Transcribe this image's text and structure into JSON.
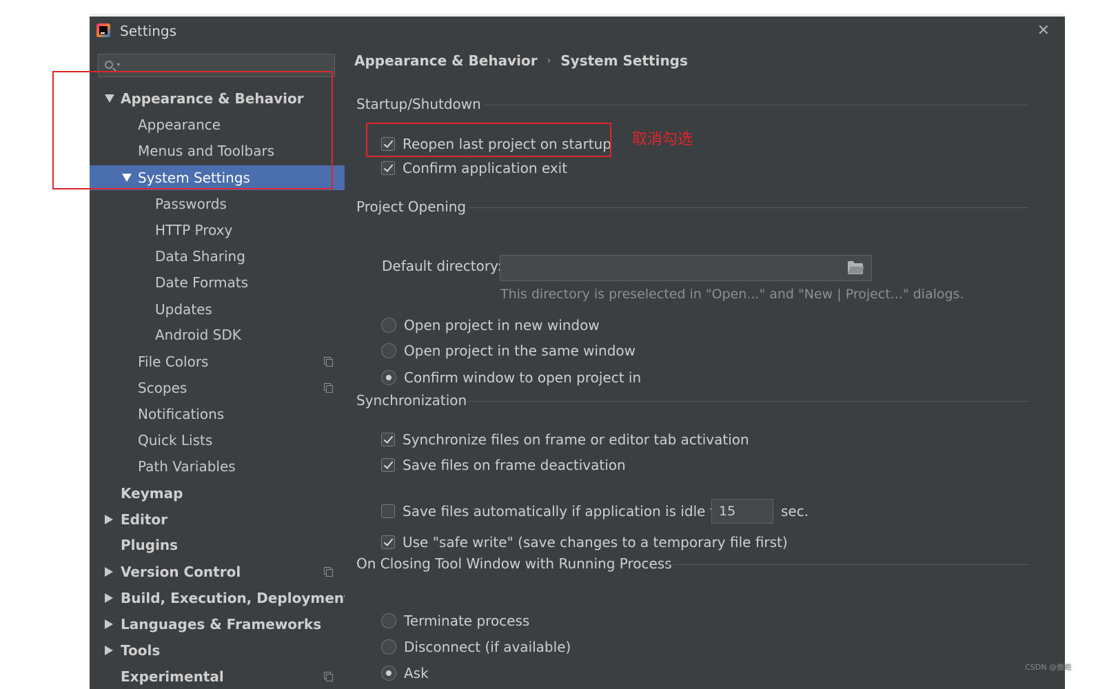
{
  "window": {
    "title": "Settings"
  },
  "sidebar": {
    "search_placeholder": "",
    "items": [
      {
        "label": "Appearance & Behavior"
      },
      {
        "label": "Appearance"
      },
      {
        "label": "Menus and Toolbars"
      },
      {
        "label": "System Settings"
      },
      {
        "label": "Passwords"
      },
      {
        "label": "HTTP Proxy"
      },
      {
        "label": "Data Sharing"
      },
      {
        "label": "Date Formats"
      },
      {
        "label": "Updates"
      },
      {
        "label": "Android SDK"
      },
      {
        "label": "File Colors"
      },
      {
        "label": "Scopes"
      },
      {
        "label": "Notifications"
      },
      {
        "label": "Quick Lists"
      },
      {
        "label": "Path Variables"
      },
      {
        "label": "Keymap"
      },
      {
        "label": "Editor"
      },
      {
        "label": "Plugins"
      },
      {
        "label": "Version Control"
      },
      {
        "label": "Build, Execution, Deployment"
      },
      {
        "label": "Languages & Frameworks"
      },
      {
        "label": "Tools"
      },
      {
        "label": "Experimental"
      }
    ]
  },
  "main": {
    "breadcrumb": [
      "Appearance & Behavior",
      "System Settings"
    ],
    "breadcrumb_sep": "›",
    "startup": {
      "title": "Startup/Shutdown",
      "reopen_label": "Reopen last project on startup",
      "confirm_exit_label": "Confirm application exit"
    },
    "project_opening": {
      "title": "Project Opening",
      "default_dir_label": "Default directory:",
      "default_dir_value": "",
      "hint": "This directory is preselected in \"Open...\" and \"New | Project...\" dialogs.",
      "radio_new": "Open project in new window",
      "radio_same": "Open project in the same window",
      "radio_confirm": "Confirm window to open project in"
    },
    "sync": {
      "title": "Synchronization",
      "sync_files_label": "Synchronize files on frame or editor tab activation",
      "save_deactivation_label": "Save files on frame deactivation",
      "save_idle_label": "Save files automatically if application is idle for",
      "idle_value": "15",
      "sec_label": "sec.",
      "safe_write_label": "Use \"safe write\" (save changes to a temporary file first)"
    },
    "closing": {
      "title": "On Closing Tool Window with Running Process",
      "terminate_label": "Terminate process",
      "disconnect_label": "Disconnect (if available)",
      "ask_label": "Ask"
    }
  },
  "annotation": {
    "text": "取消勾选",
    "color": "#e0252b"
  },
  "watermark": "CSDN @傲羲",
  "colors": {
    "background": "#3c3f41",
    "selected": "#4b6eaf",
    "annotation": "#e0252b"
  }
}
